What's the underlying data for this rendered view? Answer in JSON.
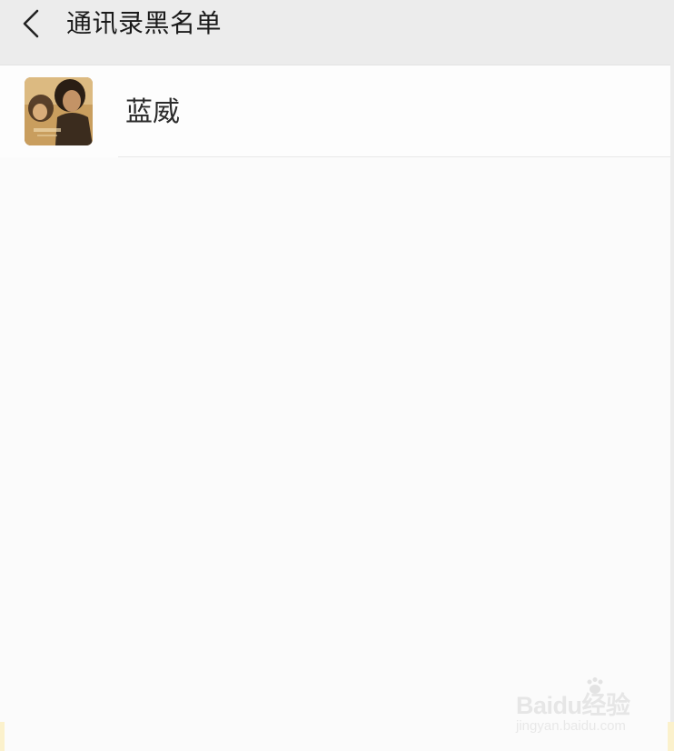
{
  "header": {
    "title": "通讯录黑名单",
    "back_icon": "chevron-left-icon"
  },
  "blacklist": [
    {
      "name": "蓝威",
      "avatar": "contact-avatar-photo"
    }
  ],
  "watermark": {
    "logo_text": "Baidu经验",
    "subtext": "jingyan.baidu.com"
  },
  "colors": {
    "header_bg": "#ececec",
    "page_bg": "#fbfbfb",
    "title_text": "#1a1a1a",
    "name_text": "#2b2b2b",
    "accent_yellow": "#fbf1cc"
  }
}
